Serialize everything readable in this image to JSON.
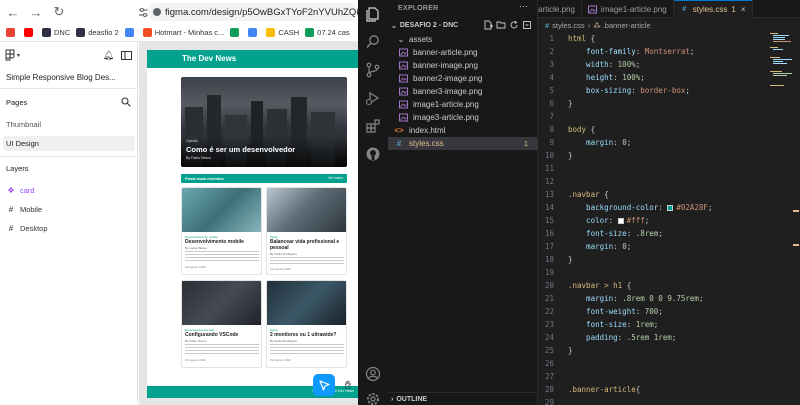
{
  "browser": {
    "url": "figma.com/design/p5OwBGxTYoF2nYVUhZQkzB/Sim",
    "bookmarks": [
      {
        "label": "",
        "color": "#ea4335"
      },
      {
        "label": "",
        "color": "#ff0000"
      },
      {
        "label": "DNC",
        "color": "#2d3142"
      },
      {
        "label": "deasfio 2",
        "color": "#2d3142"
      },
      {
        "label": "",
        "color": "#4285f4"
      },
      {
        "label": "Hotmart - Minhas c...",
        "color": "#f04e23"
      },
      {
        "label": "",
        "color": "#0f9d58"
      },
      {
        "label": "",
        "color": "#4285f4"
      },
      {
        "label": "CASH",
        "color": "#fbbc04"
      },
      {
        "label": "07.24 cas",
        "color": "#0f9d58"
      }
    ]
  },
  "figma": {
    "file_title": "Simple Responsive Blog Des...",
    "pages_label": "Pages",
    "pages": [
      "Thumbnail",
      "UI Design"
    ],
    "active_page": "UI Design",
    "layers_label": "Layers",
    "layers": [
      {
        "name": "card",
        "color": "#9747ff"
      },
      {
        "name": "Mobile",
        "color": "#333333"
      },
      {
        "name": "Desktop",
        "color": "#333333"
      }
    ]
  },
  "design": {
    "nav_title": "The Dev News",
    "banner_tag": "Opinião",
    "banner_title": "Como é ser um desenvolvedor",
    "banner_author": "By Fabio Tetsuo",
    "recent_label": "Posts mais recentes",
    "recent_all": "Ver todos",
    "footer_text": "Copyright@The Dev News",
    "cards": [
      {
        "category": "Desenvolvimento mobile",
        "title": "Desenvolvimento mobile",
        "author": "By Lucas Tatsuo",
        "date": "23 Agosto 2022"
      },
      {
        "category": "Setup",
        "title": "Balancear vida profissional e pessoal",
        "author": "By Pedro Rodrigues",
        "date": "23 Agosto 2022"
      },
      {
        "category": "Desenvolvimento web",
        "title": "Configurando VSCode",
        "author": "By Fabio Tetsuo",
        "date": "23 Agosto 2022"
      },
      {
        "category": "Setup",
        "title": "2 monitores ou 1 ultrawide?",
        "author": "By Pedro Rodrigues",
        "date": "23 Agosto 2022"
      }
    ]
  },
  "vscode": {
    "explorer_label": "EXPLORER",
    "folder_name": "DESAFIO 2 - DNC",
    "tree": [
      {
        "name": "assets",
        "type": "folder"
      },
      {
        "name": "banner-article.png",
        "type": "image"
      },
      {
        "name": "banner-image.png",
        "type": "image"
      },
      {
        "name": "banner2-image.png",
        "type": "image"
      },
      {
        "name": "banner3-image.png",
        "type": "image"
      },
      {
        "name": "image1-article.png",
        "type": "image"
      },
      {
        "name": "image3-article.png",
        "type": "image"
      },
      {
        "name": "index.html",
        "type": "html"
      },
      {
        "name": "styles.css",
        "type": "css",
        "badge": "1"
      }
    ],
    "outline_label": "OUTLINE",
    "tabs": [
      {
        "label": "article.png",
        "type": "image"
      },
      {
        "label": "image1-article.png",
        "type": "image"
      },
      {
        "label": "styles.css",
        "type": "css",
        "badge": "1",
        "active": true
      }
    ],
    "breadcrumb": [
      "styles.css",
      ".banner-article"
    ],
    "code_lines": [
      {
        "n": "1",
        "parts": [
          [
            "sel",
            "html"
          ],
          [
            "pun",
            " {"
          ]
        ]
      },
      {
        "n": "2",
        "parts": [
          [
            "prop",
            "    font-family"
          ],
          [
            "pun",
            ": "
          ],
          [
            "val",
            "Montserrat"
          ],
          [
            "pun",
            ";"
          ]
        ]
      },
      {
        "n": "3",
        "parts": [
          [
            "prop",
            "    width"
          ],
          [
            "pun",
            ": "
          ],
          [
            "num",
            "100%"
          ],
          [
            "pun",
            ";"
          ]
        ]
      },
      {
        "n": "4",
        "parts": [
          [
            "prop",
            "    height"
          ],
          [
            "pun",
            ": "
          ],
          [
            "num",
            "100%"
          ],
          [
            "pun",
            ";"
          ]
        ]
      },
      {
        "n": "5",
        "parts": [
          [
            "prop",
            "    box-sizing"
          ],
          [
            "pun",
            ": "
          ],
          [
            "val",
            "border-box"
          ],
          [
            "pun",
            ";"
          ]
        ]
      },
      {
        "n": "6",
        "parts": [
          [
            "pun",
            "}"
          ]
        ]
      },
      {
        "n": "7",
        "parts": []
      },
      {
        "n": "8",
        "parts": [
          [
            "sel",
            "body"
          ],
          [
            "pun",
            " {"
          ]
        ]
      },
      {
        "n": "9",
        "parts": [
          [
            "prop",
            "    margin"
          ],
          [
            "pun",
            ": "
          ],
          [
            "num",
            "0"
          ],
          [
            "pun",
            ";"
          ]
        ]
      },
      {
        "n": "10",
        "parts": [
          [
            "pun",
            "}"
          ]
        ]
      },
      {
        "n": "11",
        "parts": []
      },
      {
        "n": "12",
        "parts": []
      },
      {
        "n": "13",
        "parts": [
          [
            "sel",
            ".navbar"
          ],
          [
            "pun",
            " {"
          ]
        ]
      },
      {
        "n": "14",
        "parts": [
          [
            "prop",
            "    background-color"
          ],
          [
            "pun",
            ": "
          ],
          [
            "swatch",
            "#02A28F"
          ],
          [
            "val",
            "#02A28F"
          ],
          [
            "pun",
            ";"
          ]
        ]
      },
      {
        "n": "15",
        "parts": [
          [
            "prop",
            "    color"
          ],
          [
            "pun",
            ": "
          ],
          [
            "swatch",
            "#ffffff"
          ],
          [
            "val",
            "#fff"
          ],
          [
            "pun",
            ";"
          ]
        ]
      },
      {
        "n": "16",
        "parts": [
          [
            "prop",
            "    font-size"
          ],
          [
            "pun",
            ": "
          ],
          [
            "num",
            ".8rem"
          ],
          [
            "pun",
            ";"
          ]
        ]
      },
      {
        "n": "17",
        "parts": [
          [
            "prop",
            "    margin"
          ],
          [
            "pun",
            ": "
          ],
          [
            "num",
            "0"
          ],
          [
            "pun",
            ";"
          ]
        ]
      },
      {
        "n": "18",
        "parts": [
          [
            "pun",
            "}"
          ]
        ]
      },
      {
        "n": "19",
        "parts": []
      },
      {
        "n": "20",
        "parts": [
          [
            "sel",
            ".navbar > h1"
          ],
          [
            "pun",
            " {"
          ]
        ]
      },
      {
        "n": "21",
        "parts": [
          [
            "prop",
            "    margin"
          ],
          [
            "pun",
            ": "
          ],
          [
            "num",
            ".8rem 0 0 9.75rem"
          ],
          [
            "pun",
            ";"
          ]
        ]
      },
      {
        "n": "22",
        "parts": [
          [
            "prop",
            "    font-weight"
          ],
          [
            "pun",
            ": "
          ],
          [
            "num",
            "700"
          ],
          [
            "pun",
            ";"
          ]
        ]
      },
      {
        "n": "23",
        "parts": [
          [
            "prop",
            "    font-size"
          ],
          [
            "pun",
            ": "
          ],
          [
            "num",
            "1rem"
          ],
          [
            "pun",
            ";"
          ]
        ]
      },
      {
        "n": "24",
        "parts": [
          [
            "prop",
            "    padding"
          ],
          [
            "pun",
            ": "
          ],
          [
            "num",
            ".5rem 1rem"
          ],
          [
            "pun",
            ";"
          ]
        ]
      },
      {
        "n": "25",
        "parts": [
          [
            "pun",
            "}"
          ]
        ]
      },
      {
        "n": "26",
        "parts": []
      },
      {
        "n": "27",
        "parts": []
      },
      {
        "n": "28",
        "parts": [
          [
            "sel",
            ".banner-article"
          ],
          [
            "pun",
            "{"
          ]
        ]
      },
      {
        "n": "29",
        "parts": []
      },
      {
        "n": "30",
        "parts": [
          [
            "pun",
            "}"
          ]
        ]
      }
    ]
  },
  "colors": {
    "accent": "#02A28F",
    "vscode_bg": "#1f1f1f",
    "figma_selection": "#0d99ff"
  }
}
